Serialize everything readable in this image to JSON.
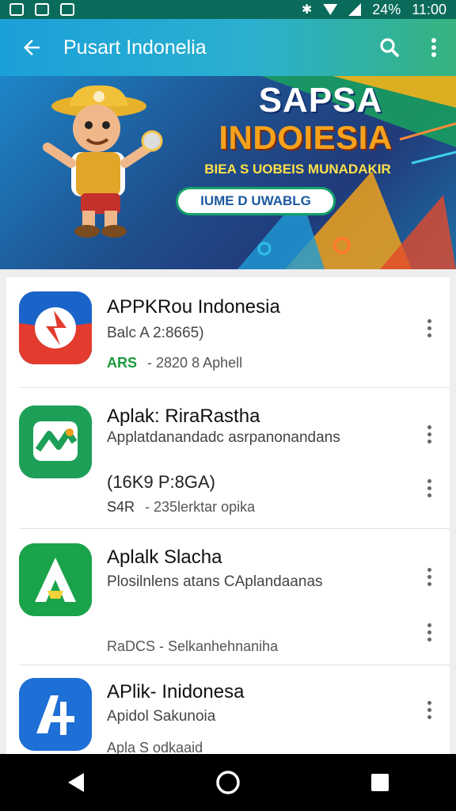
{
  "status_bar": {
    "battery": "24%",
    "time": "11:00"
  },
  "app_bar": {
    "title": "Pusart Indonelia"
  },
  "banner": {
    "title_line1": "SAPSA",
    "title_line2": "INDOIESIA",
    "subtitle": "BIEA S UOBEIS MUNADAKIR",
    "button_label": "IUME D UWABLG",
    "colors": {
      "title": "#ffffff",
      "title2": "#f7a21b",
      "subtitle": "#ffe14a"
    }
  },
  "apps": [
    {
      "title": "APPKRou Indonesia",
      "subtitle": "Balc A 2:8665)",
      "rating_text": "ARS",
      "meta": "- 2820 8 Aphell"
    },
    {
      "title": "Aplak: RiraRastha",
      "subtitle": "Applatdanandadc asrpanonandans",
      "extra": "(16K9 P:8GA)",
      "rating_text": "S4R",
      "meta": "- 235lerktar opika"
    },
    {
      "title": "Aplalk Slacha",
      "subtitle": "Plosilnlens atans CAplandaanas",
      "meta": "RaDCS - Selkanhehnaniha"
    },
    {
      "title": "APlik- Inidonesa",
      "subtitle": "Apidol Sakunoia",
      "meta": "Apla S odkaaid"
    }
  ],
  "icons": [
    "back-arrow-icon",
    "search-icon",
    "more-vert-icon",
    "nav-back-icon",
    "nav-home-icon",
    "nav-recents-icon"
  ]
}
